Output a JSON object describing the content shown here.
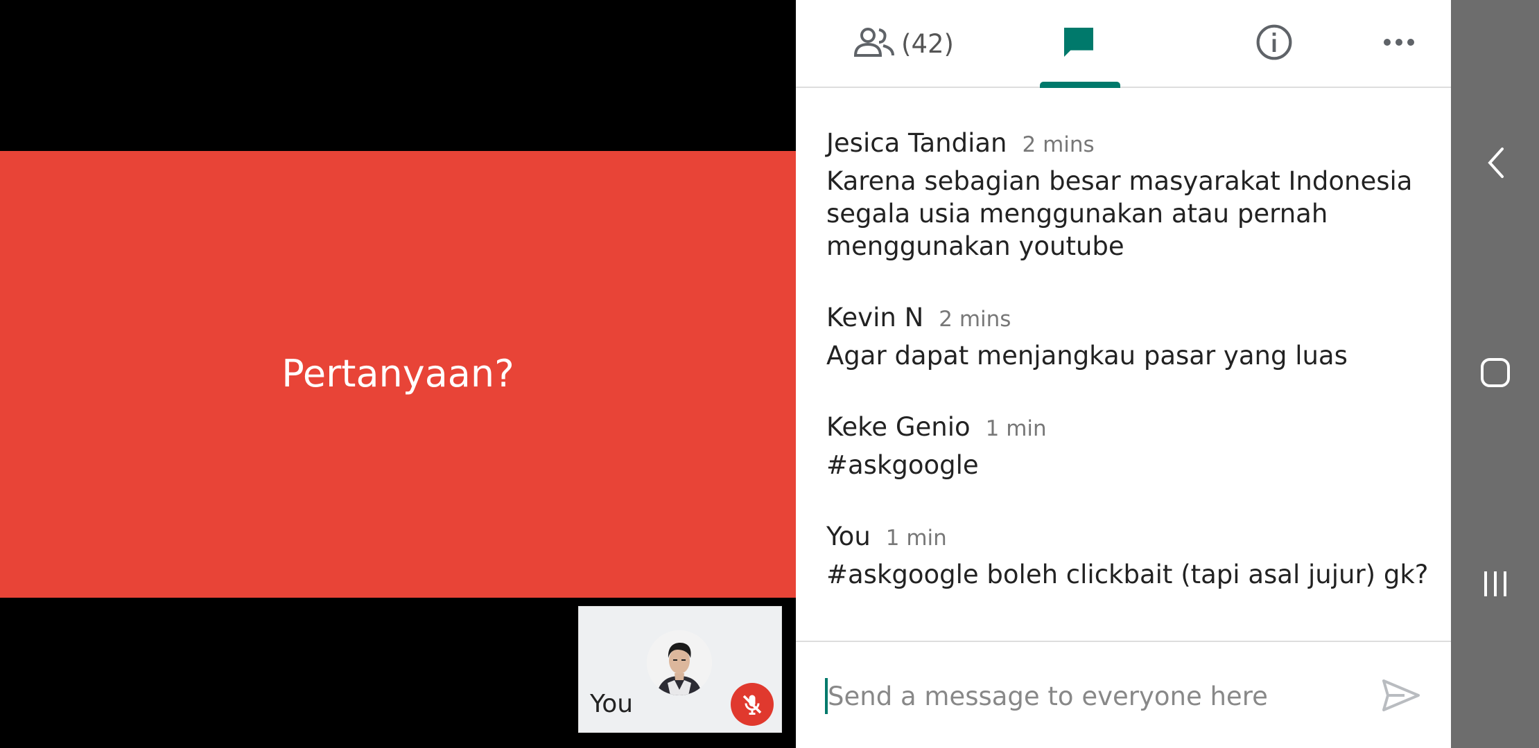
{
  "stage": {
    "slide_title": "Pertanyaan?",
    "slide_color": "#e84437",
    "self_tile": {
      "label": "You",
      "mic_icon": "mic-off-icon"
    }
  },
  "panel": {
    "tabs": {
      "people": {
        "icon": "people-icon",
        "count": "(42)"
      },
      "chat": {
        "icon": "chat-icon",
        "active": true
      },
      "info": {
        "icon": "info-icon"
      },
      "more": {
        "icon": "more-icon"
      }
    },
    "messages": [
      {
        "name": "Jesica Tandian",
        "time": "2 mins",
        "text_lines": [
          "Karena sebagian besar masyarakat Indonesia",
          "segala usia menggunakan atau pernah",
          "menggunakan youtube"
        ]
      },
      {
        "name": "Kevin N",
        "time": "2 mins",
        "text_lines": [
          "Agar dapat menjangkau pasar yang luas"
        ]
      },
      {
        "name": "Keke Genio",
        "time": "1 min",
        "text_lines": [
          "#askgoogle"
        ]
      },
      {
        "name": "You",
        "time": "1 min",
        "text_lines": [
          "#askgoogle boleh clickbait (tapi asal jujur) gk?"
        ]
      }
    ],
    "composer": {
      "placeholder": "Send a message to everyone here",
      "value": "",
      "send_icon": "send-icon"
    },
    "accent_color": "#00796b"
  },
  "navbar": {
    "buttons": [
      "back-icon",
      "home-icon",
      "recents-icon"
    ]
  }
}
